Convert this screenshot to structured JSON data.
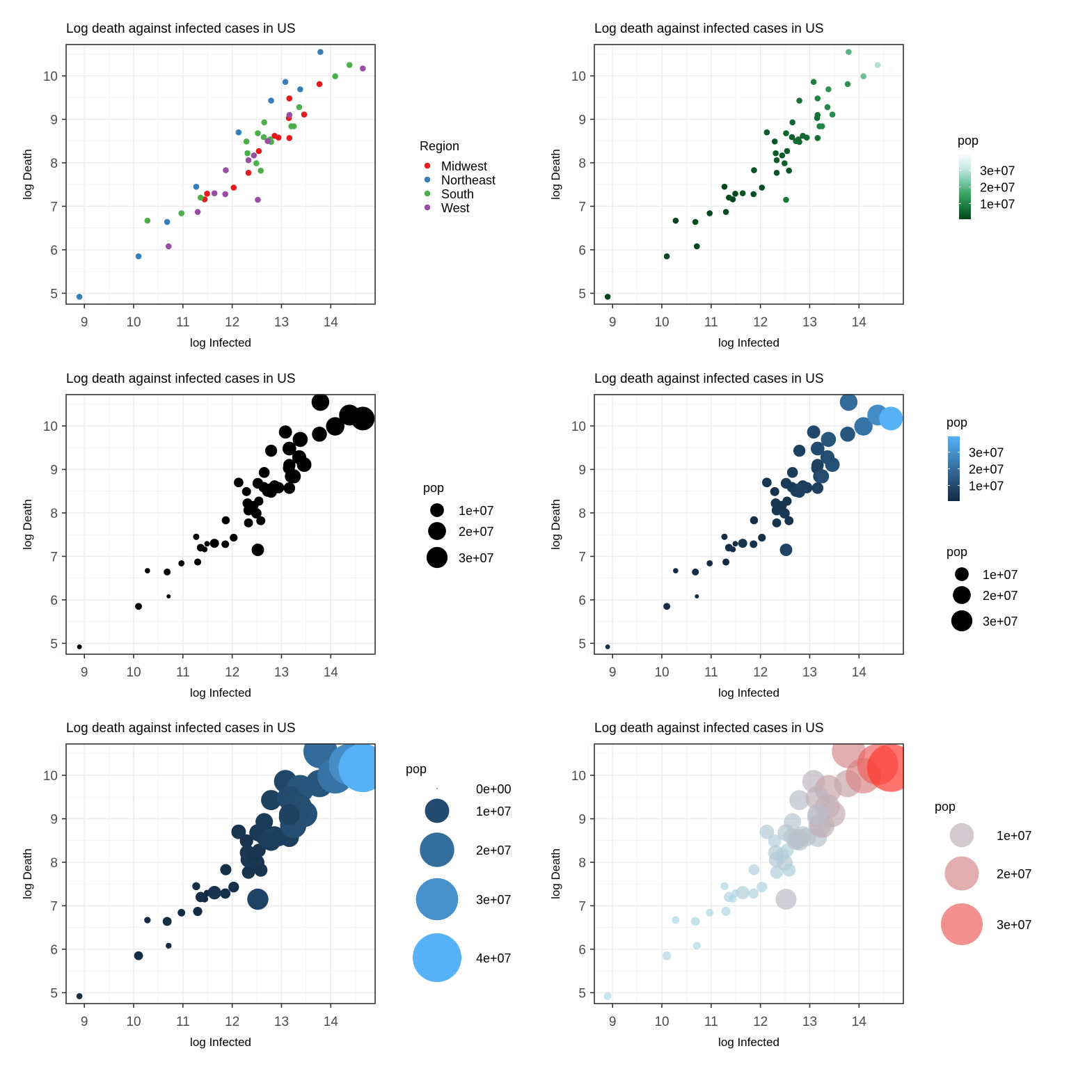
{
  "figure": {
    "title": "Log death against infected cases in US",
    "xlabel": "log Infected",
    "ylabel": "log Death"
  },
  "chart_data": {
    "type": "scatter",
    "title": "Log death against infected cases in US",
    "xlabel": "log Infected",
    "ylabel": "log Death",
    "xlim": [
      8.63,
      14.9
    ],
    "ylim": [
      4.75,
      10.72
    ],
    "xticks": [
      9,
      10,
      11,
      12,
      13,
      14
    ],
    "yticks": [
      5,
      6,
      7,
      8,
      9,
      10
    ],
    "grid": true,
    "region_colors": {
      "Midwest": "#E41A1C",
      "Northeast": "#377EB8",
      "South": "#4DAF4A",
      "West": "#984EA3"
    },
    "points": [
      {
        "x": 8.9,
        "y": 4.92,
        "region": "Northeast",
        "pop": 620000
      },
      {
        "x": 10.1,
        "y": 5.85,
        "region": "Northeast",
        "pop": 1340000
      },
      {
        "x": 10.68,
        "y": 6.64,
        "region": "Northeast",
        "pop": 1360000
      },
      {
        "x": 11.27,
        "y": 7.45,
        "region": "Northeast",
        "pop": 1060000
      },
      {
        "x": 12.13,
        "y": 8.7,
        "region": "Northeast",
        "pop": 3570000
      },
      {
        "x": 12.79,
        "y": 9.43,
        "region": "Northeast",
        "pop": 6890000
      },
      {
        "x": 13.08,
        "y": 9.86,
        "region": "Northeast",
        "pop": 8880000
      },
      {
        "x": 13.38,
        "y": 9.69,
        "region": "Northeast",
        "pop": 12800000
      },
      {
        "x": 13.79,
        "y": 10.55,
        "region": "Northeast",
        "pop": 19450000
      },
      {
        "x": 11.44,
        "y": 7.16,
        "region": "Midwest",
        "pop": 880000
      },
      {
        "x": 11.49,
        "y": 7.29,
        "region": "Midwest",
        "pop": 760000
      },
      {
        "x": 12.03,
        "y": 7.43,
        "region": "Midwest",
        "pop": 1930000
      },
      {
        "x": 12.33,
        "y": 7.77,
        "region": "Midwest",
        "pop": 2910000
      },
      {
        "x": 12.54,
        "y": 8.27,
        "region": "Midwest",
        "pop": 3160000
      },
      {
        "x": 12.86,
        "y": 8.62,
        "region": "Midwest",
        "pop": 5640000
      },
      {
        "x": 12.94,
        "y": 8.58,
        "region": "Midwest",
        "pop": 5820000
      },
      {
        "x": 13.16,
        "y": 8.57,
        "region": "Midwest",
        "pop": 6140000
      },
      {
        "x": 13.15,
        "y": 9.03,
        "region": "Midwest",
        "pop": 6730000
      },
      {
        "x": 13.46,
        "y": 9.11,
        "region": "Midwest",
        "pop": 11690000
      },
      {
        "x": 13.16,
        "y": 9.48,
        "region": "Midwest",
        "pop": 9990000
      },
      {
        "x": 13.77,
        "y": 9.81,
        "region": "Midwest",
        "pop": 12670000
      },
      {
        "x": 10.28,
        "y": 6.67,
        "region": "South",
        "pop": 710000
      },
      {
        "x": 10.97,
        "y": 6.84,
        "region": "South",
        "pop": 970000
      },
      {
        "x": 11.36,
        "y": 7.2,
        "region": "South",
        "pop": 1790000
      },
      {
        "x": 12.29,
        "y": 8.49,
        "region": "South",
        "pop": 3020000
      },
      {
        "x": 12.31,
        "y": 8.22,
        "region": "South",
        "pop": 3960000
      },
      {
        "x": 12.49,
        "y": 7.99,
        "region": "South",
        "pop": 4470000
      },
      {
        "x": 12.58,
        "y": 7.82,
        "region": "South",
        "pop": 2980000
      },
      {
        "x": 12.52,
        "y": 8.68,
        "region": "South",
        "pop": 4900000
      },
      {
        "x": 12.64,
        "y": 8.59,
        "region": "South",
        "pop": 4650000
      },
      {
        "x": 12.65,
        "y": 8.93,
        "region": "South",
        "pop": 5150000
      },
      {
        "x": 12.77,
        "y": 8.54,
        "region": "South",
        "pop": 6830000
      },
      {
        "x": 12.79,
        "y": 8.48,
        "region": "South",
        "pop": 6050000
      },
      {
        "x": 13.2,
        "y": 8.84,
        "region": "South",
        "pop": 8540000
      },
      {
        "x": 13.25,
        "y": 8.84,
        "region": "South",
        "pop": 10490000
      },
      {
        "x": 13.36,
        "y": 9.28,
        "region": "South",
        "pop": 10620000
      },
      {
        "x": 14.09,
        "y": 9.99,
        "region": "South",
        "pop": 21480000
      },
      {
        "x": 14.38,
        "y": 10.25,
        "region": "South",
        "pop": 29000000
      },
      {
        "x": 10.71,
        "y": 6.08,
        "region": "West",
        "pop": 580000
      },
      {
        "x": 11.3,
        "y": 6.87,
        "region": "West",
        "pop": 1420000
      },
      {
        "x": 11.64,
        "y": 7.3,
        "region": "West",
        "pop": 3050000
      },
      {
        "x": 11.86,
        "y": 7.28,
        "region": "West",
        "pop": 1790000
      },
      {
        "x": 11.87,
        "y": 7.83,
        "region": "West",
        "pop": 2100000
      },
      {
        "x": 12.33,
        "y": 8.06,
        "region": "West",
        "pop": 4220000
      },
      {
        "x": 12.44,
        "y": 8.17,
        "region": "West",
        "pop": 3210000
      },
      {
        "x": 12.52,
        "y": 7.15,
        "region": "West",
        "pop": 7610000
      },
      {
        "x": 12.72,
        "y": 8.5,
        "region": "West",
        "pop": 5760000
      },
      {
        "x": 13.16,
        "y": 9.1,
        "region": "West",
        "pop": 7280000
      },
      {
        "x": 14.65,
        "y": 10.17,
        "region": "West",
        "pop": 39510000
      }
    ],
    "panels": [
      {
        "id": "region-color",
        "aesthetic": "color=region",
        "legend": {
          "title": "Region",
          "items": [
            "Midwest",
            "Northeast",
            "South",
            "West"
          ]
        }
      },
      {
        "id": "pop-color-bugn",
        "aesthetic": "color=pop",
        "legend": {
          "title": "pop",
          "colorbar_labels": [
            "3e+07",
            "2e+07",
            "1e+07"
          ],
          "colorbar_values": [
            30000000,
            20000000,
            10000000
          ],
          "low_color": "#00441B",
          "high_color": "#F7FCFD"
        }
      },
      {
        "id": "pop-size",
        "aesthetic": "size=pop",
        "legend": {
          "title": "pop",
          "size_labels": [
            "1e+07",
            "2e+07",
            "3e+07"
          ],
          "size_values": [
            10000000,
            20000000,
            30000000
          ]
        }
      },
      {
        "id": "pop-color-size",
        "aesthetic": "color=pop,size=pop",
        "legend": {
          "title": "pop",
          "colorbar_labels": [
            "3e+07",
            "2e+07",
            "1e+07"
          ],
          "colorbar_values": [
            30000000,
            20000000,
            10000000
          ],
          "low_color": "#132B43",
          "high_color": "#56B1F7",
          "size_title": "pop",
          "size_labels": [
            "1e+07",
            "2e+07",
            "3e+07"
          ],
          "size_values": [
            10000000,
            20000000,
            30000000
          ]
        }
      },
      {
        "id": "pop-combined-area",
        "aesthetic": "color=pop,size=pop (combined legend)",
        "legend": {
          "title": "pop",
          "size_labels": [
            "0e+00",
            "1e+07",
            "2e+07",
            "3e+07",
            "4e+07"
          ],
          "size_values": [
            0,
            10000000,
            20000000,
            30000000,
            40000000
          ],
          "low_color": "#132B43",
          "high_color": "#56B1F7"
        }
      },
      {
        "id": "pop-combined-red",
        "aesthetic": "color=pop,size=pop, alpha",
        "legend": {
          "title": "pop",
          "size_labels": [
            "1e+07",
            "2e+07",
            "3e+07"
          ],
          "size_values": [
            10000000,
            20000000,
            30000000
          ],
          "low_color": "#ADD8E6",
          "high_color": "#FF3B30",
          "alpha": 0.7
        }
      }
    ]
  }
}
